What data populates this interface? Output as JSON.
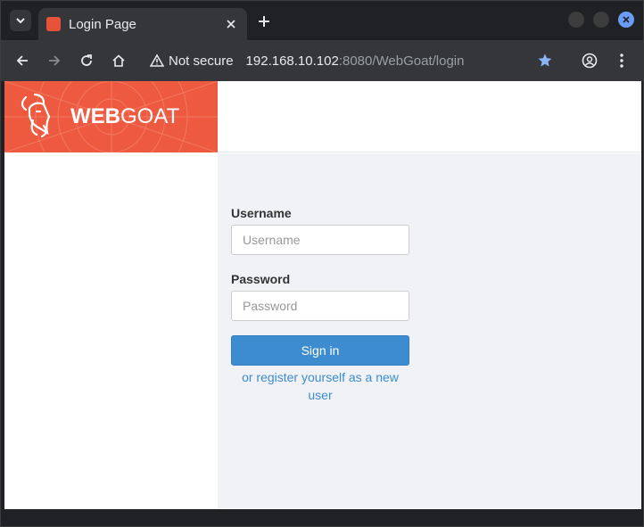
{
  "browser": {
    "tab": {
      "title": "Login Page",
      "favicon": "webgoat-favicon"
    },
    "toolbar": {
      "security_text": "Not secure",
      "url_host": "192.168.10.102",
      "url_rest": ":8080/WebGoat/login"
    }
  },
  "brand": {
    "name_bold": "WEB",
    "name_rest": "GOAT",
    "color": "#ee5a3f"
  },
  "login": {
    "username_label": "Username",
    "username_placeholder": "Username",
    "password_label": "Password",
    "password_placeholder": "Password",
    "signin_label": "Sign in",
    "register_text": "or register yourself as a new user"
  },
  "colors": {
    "accent": "#3d8ccf",
    "background": "#f0f2f5"
  }
}
